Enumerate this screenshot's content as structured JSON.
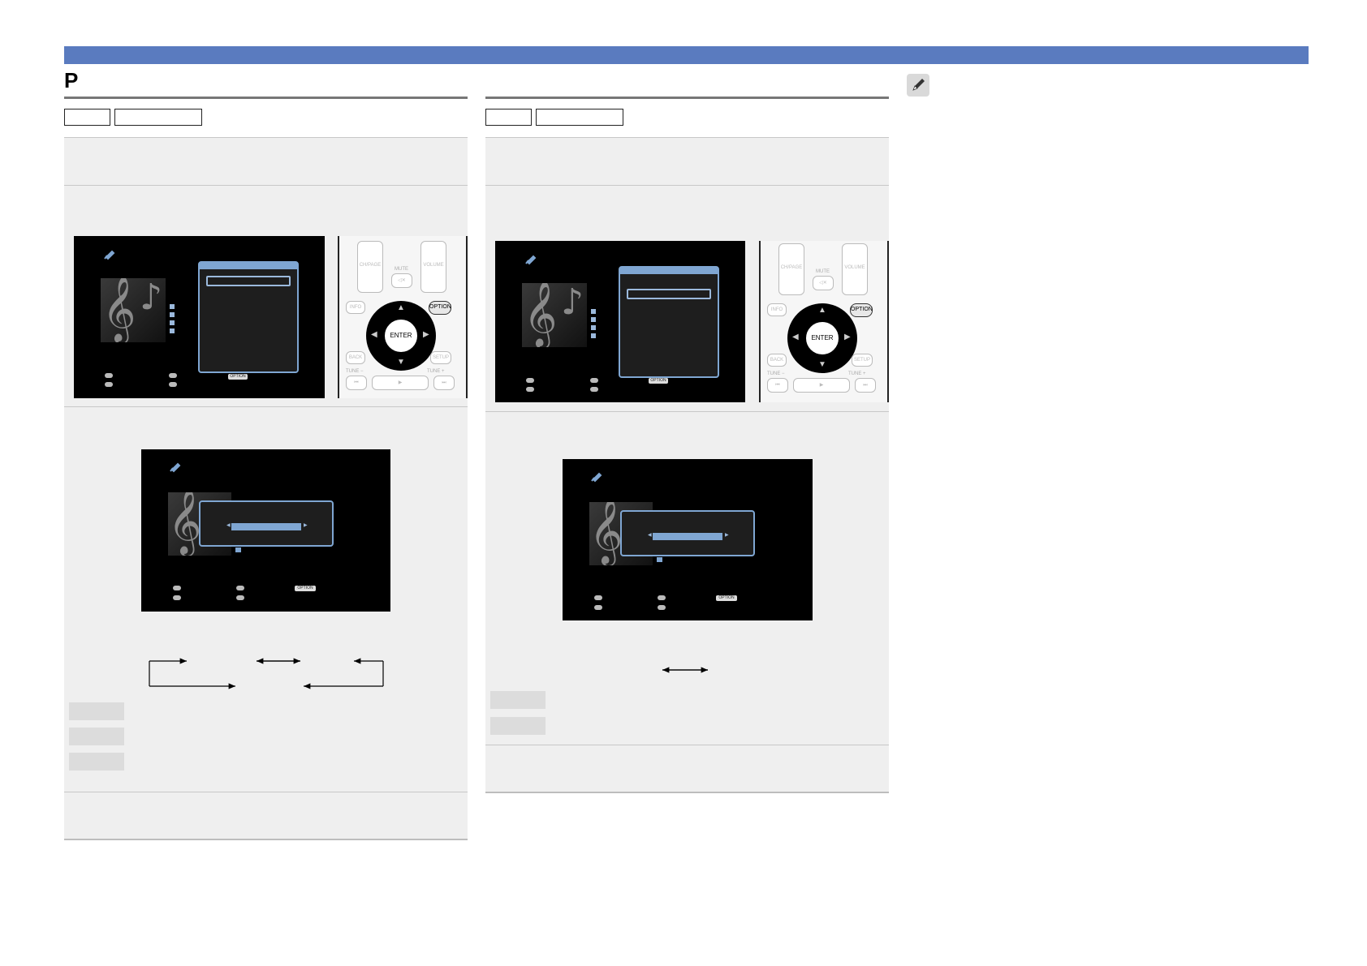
{
  "header": {
    "page_letter": "P"
  },
  "columns": [
    {
      "tag_labels": [
        "",
        ""
      ],
      "option_key_label": "OPTION",
      "enter_label": "ENTER"
    },
    {
      "tag_labels": [
        "",
        ""
      ],
      "option_key_label": "OPTION",
      "enter_label": "ENTER"
    }
  ],
  "screen": {
    "option_badge": "OPTION"
  },
  "remote": {
    "ch_page": "CH/PAGE",
    "mute": "MUTE",
    "volume": "VOLUME",
    "info": "INFO",
    "option": "OPTION",
    "enter": "ENTER",
    "back": "BACK",
    "setup": "SETUP",
    "tune_minus": "TUNE −",
    "tune_plus": "TUNE +"
  },
  "colors": {
    "accent_bar": "#5a7bbf",
    "screen_highlight": "#7fa6d2"
  },
  "icons": [
    "pencil-icon",
    "usb-icon",
    "music-note-icon",
    "arrow-icon"
  ]
}
